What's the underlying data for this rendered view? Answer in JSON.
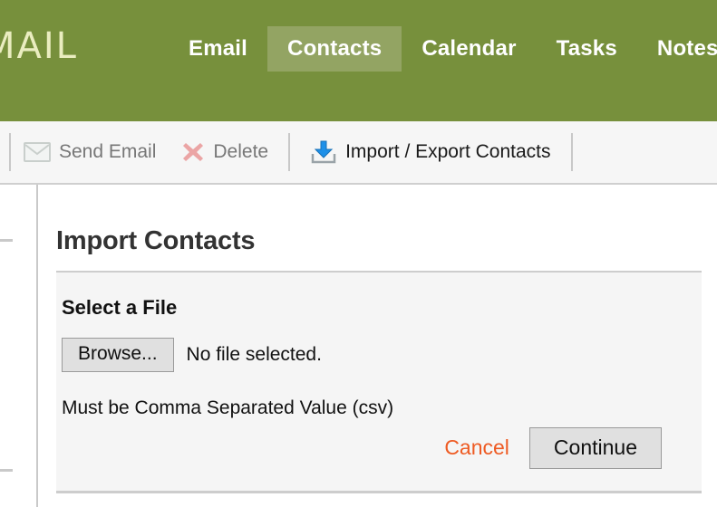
{
  "header": {
    "logo_text": "MAIL",
    "background_color": "#77903c",
    "active_tab_color": "#93a463",
    "nav": [
      {
        "label": "Email",
        "active": false
      },
      {
        "label": "Contacts",
        "active": true
      },
      {
        "label": "Calendar",
        "active": false
      },
      {
        "label": "Tasks",
        "active": false
      },
      {
        "label": "Notes",
        "active": false
      }
    ]
  },
  "toolbar": {
    "send_email": {
      "label": "Send Email",
      "icon": "envelope-icon",
      "enabled": false
    },
    "delete": {
      "label": "Delete",
      "icon": "red-x-icon",
      "enabled": false
    },
    "import_export": {
      "label": "Import / Export Contacts",
      "icon": "import-download-icon",
      "enabled": true
    }
  },
  "main": {
    "page_title": "Import Contacts",
    "panel_heading": "Select a File",
    "browse_label": "Browse...",
    "file_status": "No file selected.",
    "format_hint": "Must be Comma Separated Value (csv)",
    "cancel_label": "Cancel",
    "cancel_color": "#ee5b23",
    "continue_label": "Continue"
  }
}
